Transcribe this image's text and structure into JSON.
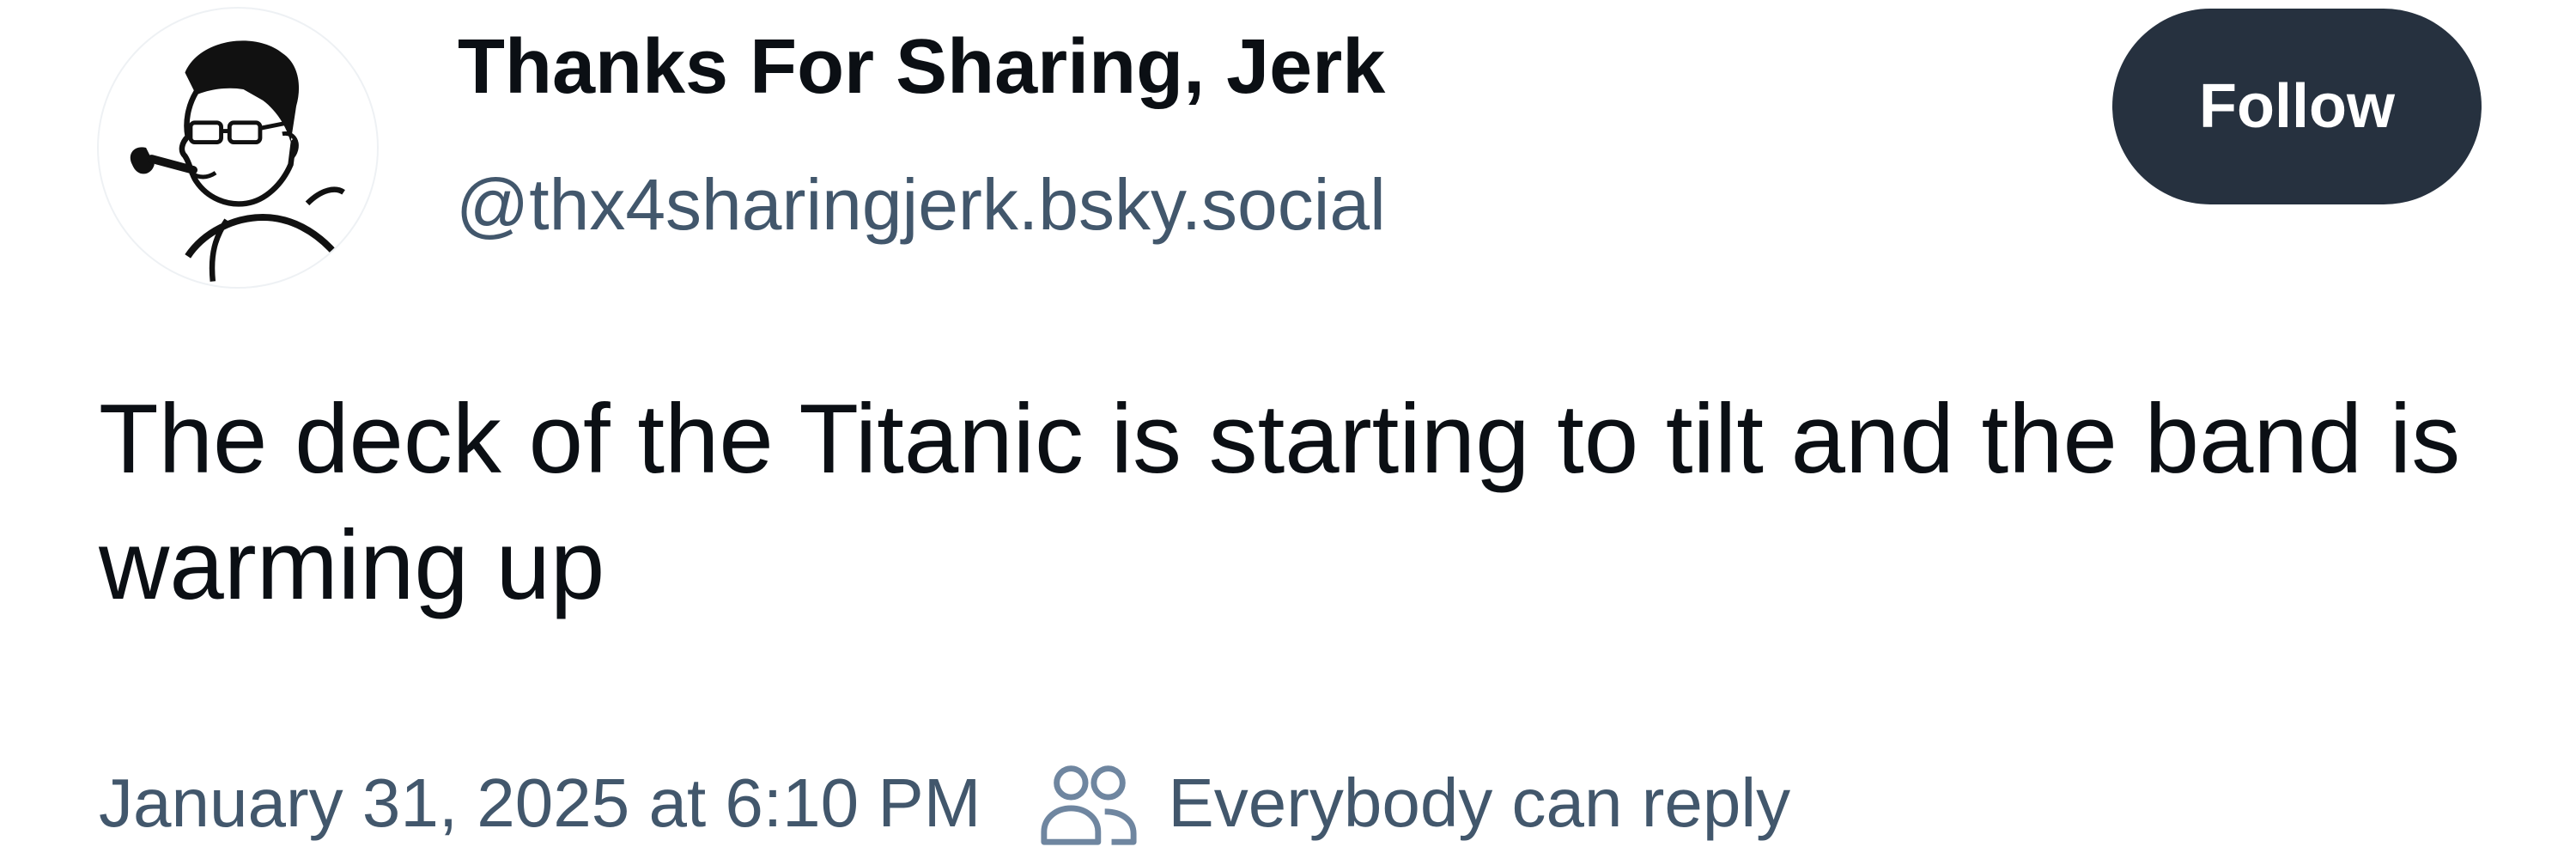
{
  "post": {
    "author": {
      "display_name": "Thanks For Sharing, Jerk",
      "handle": "@thx4sharingjerk.bsky.social",
      "avatar_icon": "pipe-smoking-man-avatar"
    },
    "follow_label": "Follow",
    "text": "The deck of the Titanic is starting to tilt and the band is warming up",
    "timestamp": "January 31, 2025 at 6:10 PM",
    "reply_setting": {
      "icon": "people-icon",
      "label": "Everybody can reply"
    }
  },
  "colors": {
    "text_primary": "#0b0f14",
    "text_secondary": "#42576c",
    "button_bg": "#26313f",
    "button_text": "#ffffff",
    "background": "#ffffff"
  }
}
